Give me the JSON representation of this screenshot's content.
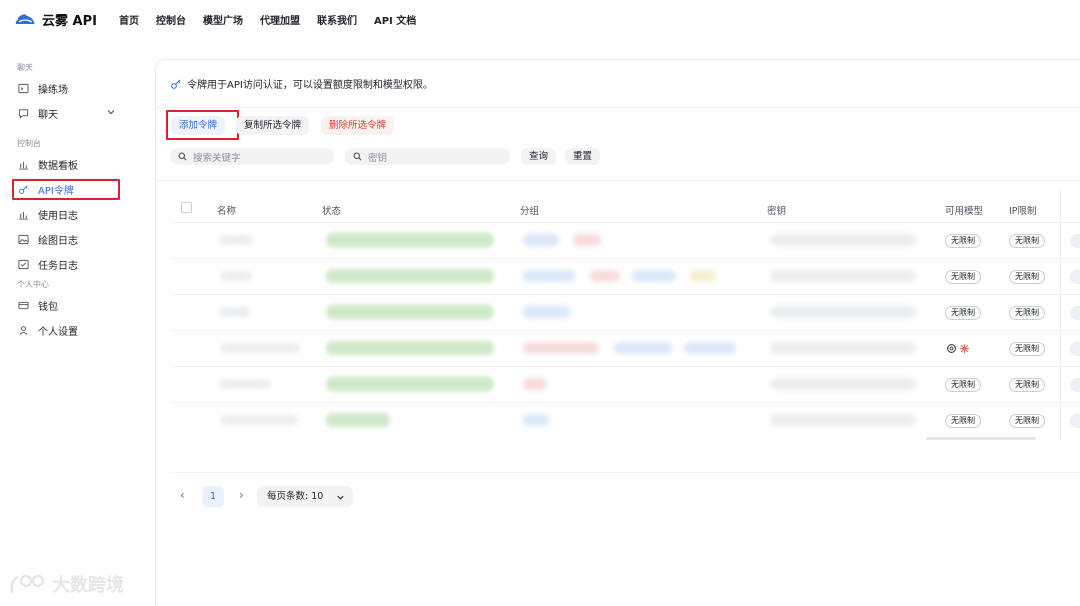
{
  "brand": {
    "name": "云雾 API"
  },
  "nav": [
    "首页",
    "控制台",
    "模型广场",
    "代理加盟",
    "联系我们",
    "API 文档"
  ],
  "sidebar": {
    "sections": [
      {
        "title": "聊天",
        "items": [
          {
            "label": "操练场",
            "icon": "playground-icon"
          },
          {
            "label": "聊天",
            "icon": "chat-icon"
          }
        ]
      },
      {
        "title": "控制台",
        "items": [
          {
            "label": "数据看板",
            "icon": "chart-icon"
          },
          {
            "label": "API令牌",
            "icon": "key-icon"
          },
          {
            "label": "使用日志",
            "icon": "chart-icon"
          },
          {
            "label": "绘图日志",
            "icon": "image-icon"
          },
          {
            "label": "任务日志",
            "icon": "task-icon"
          }
        ]
      },
      {
        "title": "个人中心",
        "items": [
          {
            "label": "钱包",
            "icon": "wallet-icon"
          },
          {
            "label": "个人设置",
            "icon": "user-icon"
          }
        ]
      }
    ],
    "active_item": "API令牌"
  },
  "notice": "令牌用于API访问认证，可以设置额度限制和模型权限。",
  "toolbar": {
    "add": "添加令牌",
    "copy": "复制所选令牌",
    "delete": "删除所选令牌"
  },
  "filters": {
    "keyword_placeholder": "搜索关键字",
    "key_placeholder": "密钥",
    "query": "查询",
    "reset": "重置"
  },
  "table": {
    "headers": [
      "名称",
      "状态",
      "分组",
      "密钥",
      "可用模型",
      "IP限制"
    ],
    "rows": [
      {
        "models": "无限制",
        "ip": "无限制"
      },
      {
        "models": "无限制",
        "ip": "无限制"
      },
      {
        "models": "无限制",
        "ip": "无限制"
      },
      {
        "models": "",
        "ip": "无限制"
      },
      {
        "models": "无限制",
        "ip": "无限制"
      },
      {
        "models": "无限制",
        "ip": "无限制"
      }
    ]
  },
  "pagination": {
    "current": "1",
    "page_size_label": "每页条数: 10"
  },
  "watermark": "大数跨境",
  "colors": {
    "accent": "#2f6bdc",
    "danger": "#d9432c",
    "highlight_box": "#d9242c"
  }
}
